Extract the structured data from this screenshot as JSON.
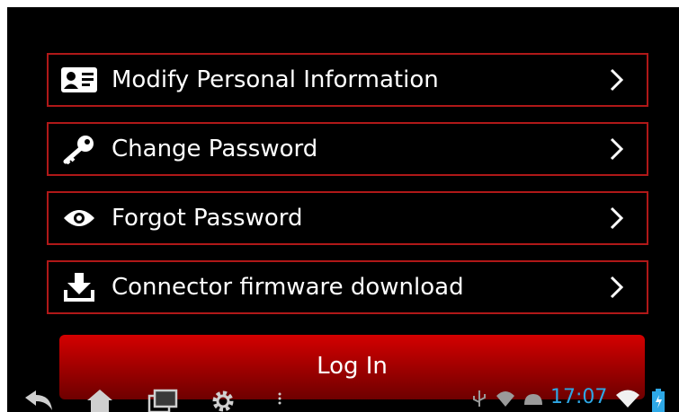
{
  "menu": {
    "items": [
      {
        "label": "Modify Personal Information",
        "icon": "id-card-icon"
      },
      {
        "label": "Change Password",
        "icon": "key-icon"
      },
      {
        "label": "Forgot Password",
        "icon": "eye-icon"
      },
      {
        "label": "Connector firmware download",
        "icon": "download-icon"
      }
    ]
  },
  "login": {
    "label": "Log In"
  },
  "status_bar": {
    "time": "17:07"
  },
  "colors": {
    "border": "#b01818",
    "button": "#b00000",
    "clock": "#2ea8e6"
  }
}
